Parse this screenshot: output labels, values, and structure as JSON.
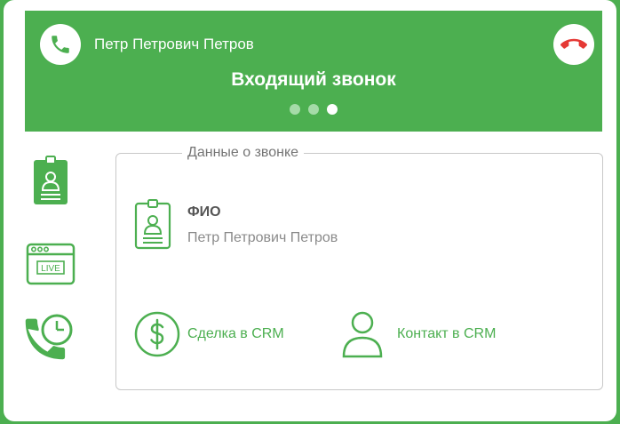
{
  "header": {
    "caller_name": "Петр Петрович Петров",
    "call_status": "Входящий звонок",
    "dots": [
      {
        "active": true
      },
      {
        "active": true
      },
      {
        "active": false
      }
    ]
  },
  "sidebar": {
    "items": [
      {
        "icon": "contact-card-icon",
        "badge_text": ""
      },
      {
        "icon": "live-window-icon",
        "badge_text": "LIVE"
      },
      {
        "icon": "call-history-icon",
        "badge_text": ""
      }
    ]
  },
  "panel": {
    "legend": "Данные о звонке",
    "fio": {
      "label": "ФИО",
      "value": "Петр Петрович Петров"
    },
    "deal_link": "Сделка в CRM",
    "contact_link": "Контакт в CRM"
  },
  "colors": {
    "brand_green": "#4caf50",
    "hangup_red": "#e53935",
    "dot_active": "#a5dba8",
    "dot_inactive": "#ffffff"
  }
}
